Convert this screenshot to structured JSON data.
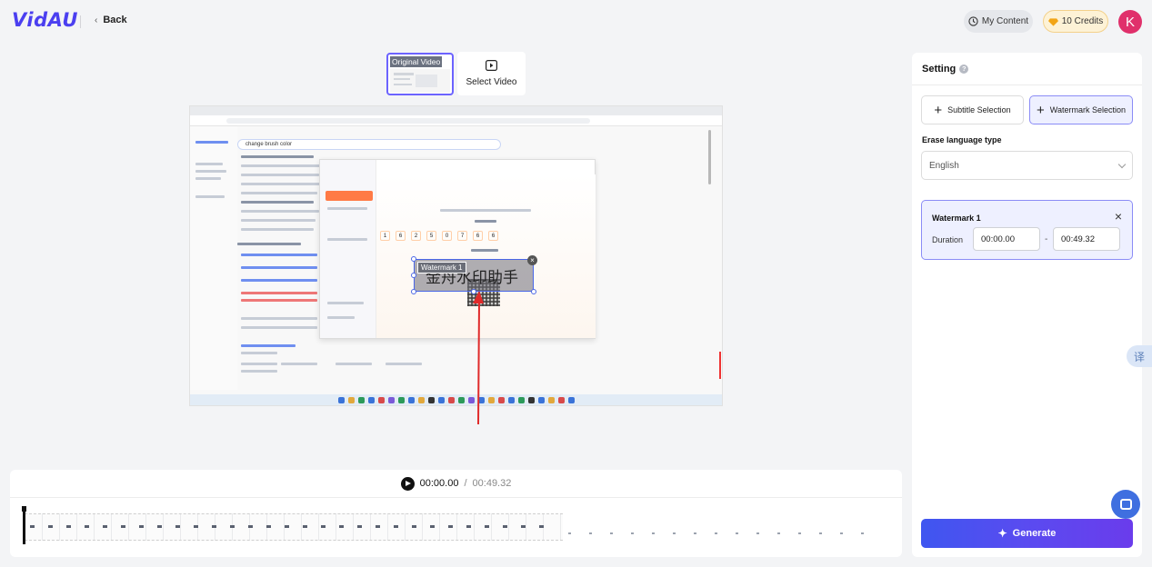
{
  "header": {
    "logo": "VidAU",
    "back_label": "Back",
    "my_content_label": "My Content",
    "credits_label": "10 Credits",
    "avatar_initial": "K"
  },
  "source_tabs": {
    "original_label": "Original Video",
    "select_label": "Select Video"
  },
  "preview": {
    "search_query": "change brush color",
    "watermark_tag": "Watermark 1",
    "watermark_text": "金舟水印助手",
    "code_digits": [
      "1",
      "6",
      "2",
      "5",
      "0",
      "7",
      "6",
      "6"
    ]
  },
  "timeline": {
    "current_time": "00:00.00",
    "separator": "/",
    "duration": "00:49.32"
  },
  "settings": {
    "title": "Setting",
    "help_glyph": "?",
    "subtitle_btn": "Subtitle Selection",
    "watermark_btn": "Watermark Selection",
    "erase_label": "Erase language type",
    "language_value": "English",
    "watermark_card": {
      "title": "Watermark 1",
      "close_glyph": "×",
      "duration_label": "Duration",
      "start": "00:00.00",
      "dash": "-",
      "end": "00:49.32"
    },
    "generate_label": "Generate"
  },
  "floating": {
    "translate_glyph": "译"
  },
  "colors": {
    "brand": "#4b3ff0",
    "accent_border": "#8b8cf6",
    "generate_gradient_start": "#3f56f0",
    "generate_gradient_end": "#6a3cec",
    "avatar": "#e0306b",
    "arrow": "#e02a2a"
  }
}
